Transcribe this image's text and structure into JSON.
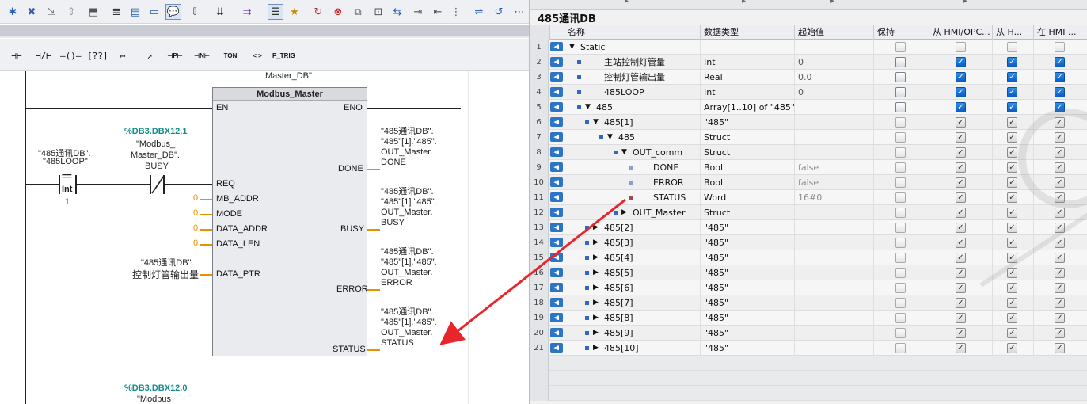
{
  "lad": {
    "toolbar2": {
      "no_contact": "⊣⊢",
      "nc_contact": "⊣/⊢",
      "coil": "–()–",
      "box": "[??]",
      "branch_open": "↦",
      "branch_close": "↗",
      "p_contact": "⊣P⊢",
      "n_contact": "⊣N⊢",
      "ton": "TON",
      "cmp": "< >",
      "p_trig": "P_TRIG"
    },
    "instance_db": "Master_DB\"",
    "block_name": "Modbus_Master",
    "pins": {
      "en": "EN",
      "eno": "ENO",
      "req": "REQ",
      "mb_addr": "MB_ADDR",
      "mode": "MODE",
      "data_addr": "DATA_ADDR",
      "data_len": "DATA_LEN",
      "data_ptr": "DATA_PTR",
      "done": "DONE",
      "busy": "BUSY",
      "error": "ERROR",
      "status": "STATUS"
    },
    "inputs": {
      "mb_addr": "0",
      "mode": "0",
      "data_addr": "0",
      "data_len": "0",
      "data_ptr_line1": "\"485通讯DB\".",
      "data_ptr_line2": "控制灯管输出量"
    },
    "cmp": {
      "op_line1": "\"485通讯DB\".",
      "op_line2": "\"485LOOP\"",
      "sym": "==",
      "type": "Int",
      "value": "1"
    },
    "busy_contact": {
      "address": "%DB3.DBX12.1",
      "line1": "\"Modbus_",
      "line2": "Master_DB\".",
      "line3": "BUSY"
    },
    "outputs": {
      "done": "\"485通讯DB\".\n\"485\"[1].\"485\".\nOUT_Master.\nDONE",
      "busy": "\"485通讯DB\".\n\"485\"[1].\"485\".\nOUT_Master.\nBUSY",
      "error": "\"485通讯DB\".\n\"485\"[1].\"485\".\nOUT_Master.\nERROR",
      "status": "\"485通讯DB\".\n\"485\"[1].\"485\".\nOUT_Master.\nSTATUS"
    },
    "next_network": {
      "address": "%DB3.DBX12.0",
      "line1": "\"Modbus"
    }
  },
  "db": {
    "title": "485通讯DB",
    "columns": [
      "名称",
      "数据类型",
      "起始值",
      "保持",
      "从 HMI/OPC...",
      "从 H...",
      "在 HMI ..."
    ],
    "rows": [
      {
        "no": "1",
        "name": "Static",
        "type": "",
        "start": "",
        "indent": 0,
        "expand": "down",
        "sq": false
      },
      {
        "no": "2",
        "name": "主站控制灯管量",
        "type": "Int",
        "start": "0",
        "indent": 1,
        "expand": "",
        "sq": true
      },
      {
        "no": "3",
        "name": "控制灯管输出量",
        "type": "Real",
        "start": "0.0",
        "indent": 1,
        "expand": "",
        "sq": true
      },
      {
        "no": "4",
        "name": "485LOOP",
        "type": "Int",
        "start": "0",
        "indent": 1,
        "expand": "",
        "sq": true
      },
      {
        "no": "5",
        "name": "485",
        "type": "Array[1..10] of \"485\"",
        "start": "",
        "indent": 1,
        "expand": "down",
        "sq": true
      },
      {
        "no": "6",
        "name": "485[1]",
        "type": "\"485\"",
        "start": "",
        "indent": 2,
        "expand": "down",
        "sq": true
      },
      {
        "no": "7",
        "name": "485",
        "type": "Struct",
        "start": "",
        "indent": 3,
        "expand": "down",
        "sq": true
      },
      {
        "no": "8",
        "name": "OUT_comm",
        "type": "Struct",
        "start": "",
        "indent": 4,
        "expand": "down",
        "sq": true
      },
      {
        "no": "9",
        "name": "DONE",
        "type": "Bool",
        "start": "false",
        "indent": 5,
        "expand": "",
        "sq": true
      },
      {
        "no": "10",
        "name": "ERROR",
        "type": "Bool",
        "start": "false",
        "indent": 5,
        "expand": "",
        "sq": true
      },
      {
        "no": "11",
        "name": "STATUS",
        "type": "Word",
        "start": "16#0",
        "indent": 5,
        "expand": "",
        "sq": true
      },
      {
        "no": "12",
        "name": "OUT_Master",
        "type": "Struct",
        "start": "",
        "indent": 4,
        "expand": "right",
        "sq": true
      },
      {
        "no": "13",
        "name": "485[2]",
        "type": "\"485\"",
        "start": "",
        "indent": 2,
        "expand": "right",
        "sq": true
      },
      {
        "no": "14",
        "name": "485[3]",
        "type": "\"485\"",
        "start": "",
        "indent": 2,
        "expand": "right",
        "sq": true
      },
      {
        "no": "15",
        "name": "485[4]",
        "type": "\"485\"",
        "start": "",
        "indent": 2,
        "expand": "right",
        "sq": true
      },
      {
        "no": "16",
        "name": "485[5]",
        "type": "\"485\"",
        "start": "",
        "indent": 2,
        "expand": "right",
        "sq": true
      },
      {
        "no": "17",
        "name": "485[6]",
        "type": "\"485\"",
        "start": "",
        "indent": 2,
        "expand": "right",
        "sq": true
      },
      {
        "no": "18",
        "name": "485[7]",
        "type": "\"485\"",
        "start": "",
        "indent": 2,
        "expand": "right",
        "sq": true
      },
      {
        "no": "19",
        "name": "485[8]",
        "type": "\"485\"",
        "start": "",
        "indent": 2,
        "expand": "right",
        "sq": true
      },
      {
        "no": "20",
        "name": "485[9]",
        "type": "\"485\"",
        "start": "",
        "indent": 2,
        "expand": "right",
        "sq": true
      },
      {
        "no": "21",
        "name": "485[10]",
        "type": "\"485\"",
        "start": "",
        "indent": 2,
        "expand": "right",
        "sq": true
      }
    ]
  },
  "colors": {
    "accent_blue": "#0a5cc6",
    "teal_address": "#0f8d8b",
    "red_highlight": "#e0304f",
    "arrow_red": "#e8252a",
    "pin_line": "#e99000"
  }
}
